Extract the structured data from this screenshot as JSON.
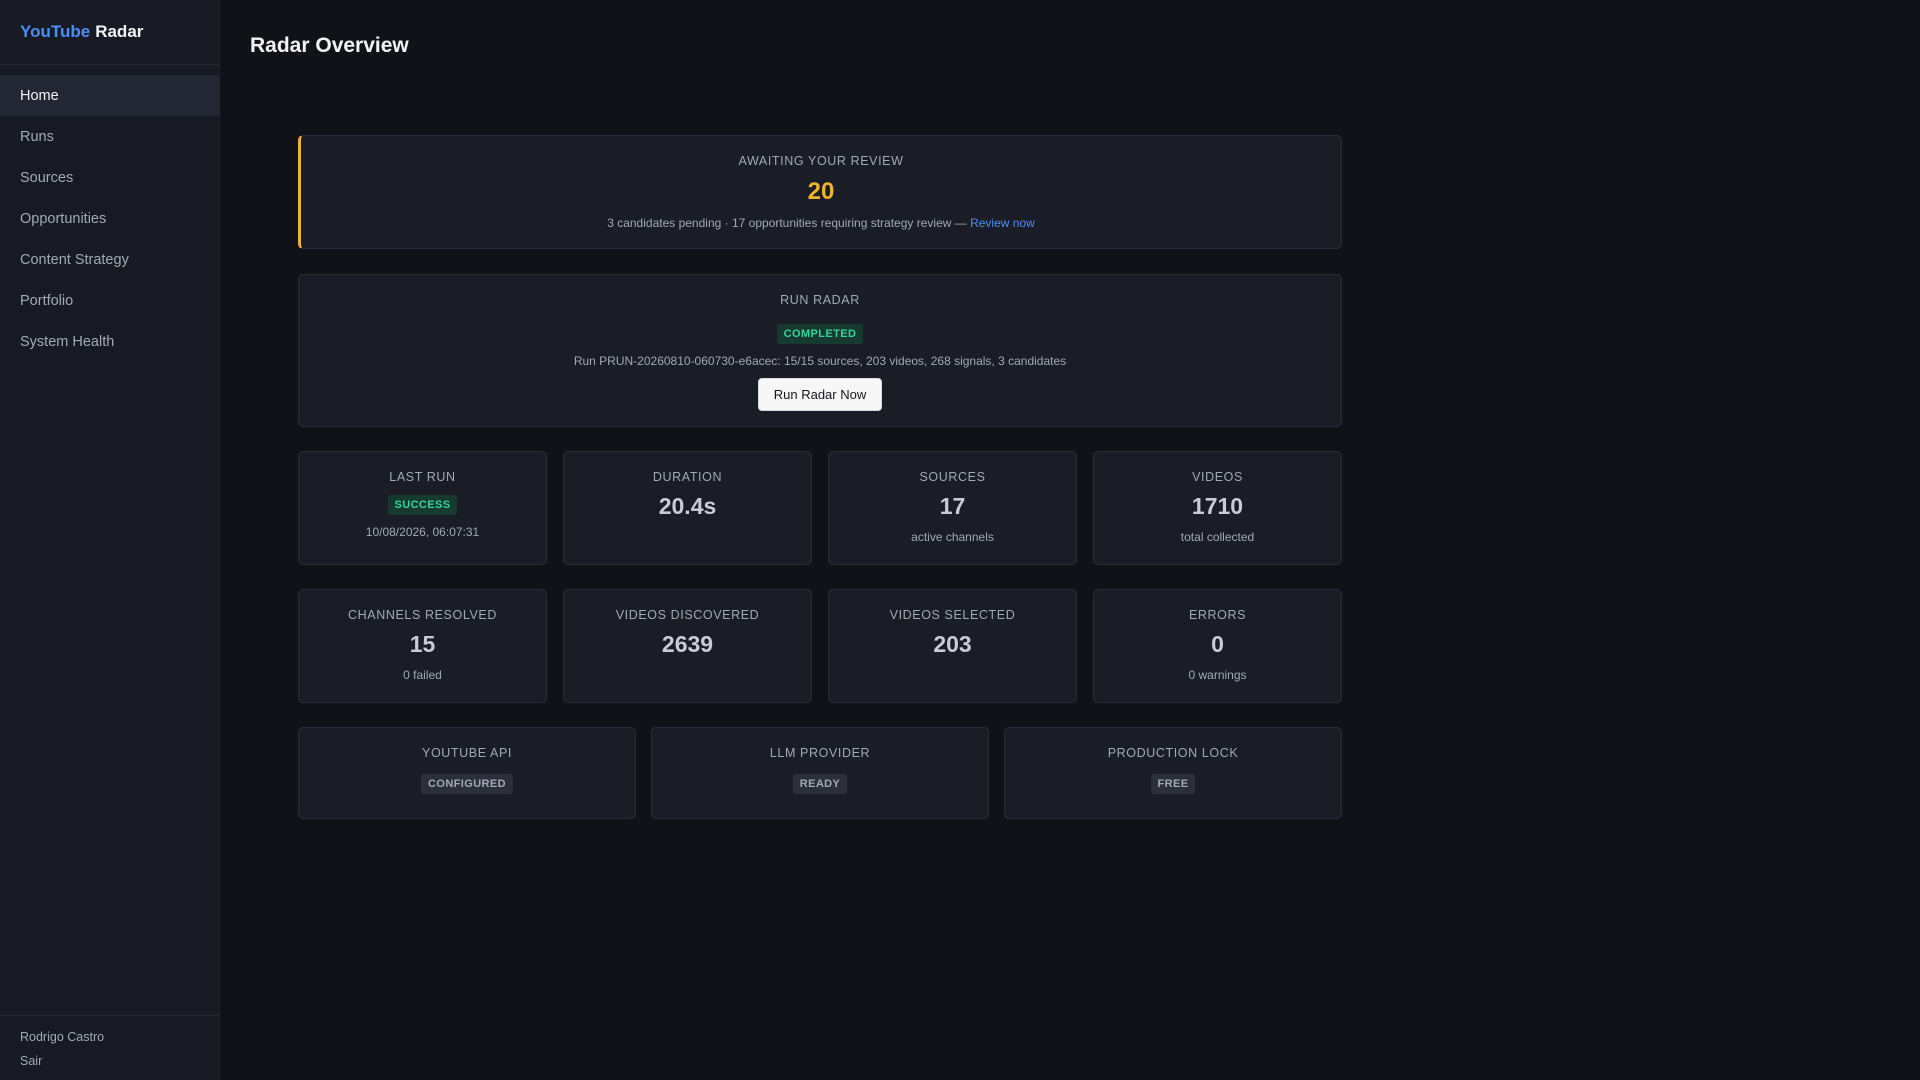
{
  "app": {
    "brand_part1": "YouTube",
    "brand_part2": "Radar",
    "accent_color": "#4a8ff7"
  },
  "sidebar": {
    "items": [
      {
        "label": "Home",
        "active": true
      },
      {
        "label": "Runs"
      },
      {
        "label": "Sources"
      },
      {
        "label": "Opportunities"
      },
      {
        "label": "Content Strategy"
      },
      {
        "label": "Portfolio"
      },
      {
        "label": "System Health"
      }
    ],
    "user_name": "Rodrigo Castro",
    "logout_label": "Sair"
  },
  "page": {
    "title": "Radar Overview"
  },
  "review": {
    "label": "AWAITING YOUR REVIEW",
    "count": "20",
    "text": "3 candidates pending · 17 opportunities requiring strategy review — ",
    "link": "Review now",
    "color": "#f0b429"
  },
  "run": {
    "label": "RUN RADAR",
    "status": "COMPLETED",
    "info": "Run PRUN-20260810-060730-e6acec: 15/15 sources, 203 videos, 268 signals, 3 candidates",
    "button": "Run Radar Now"
  },
  "stats_row1": [
    {
      "label": "LAST RUN",
      "badge": "SUCCESS",
      "sub": "10/08/2026, 06:07:31"
    },
    {
      "label": "DURATION",
      "value": "20.4s"
    },
    {
      "label": "SOURCES",
      "value": "17",
      "sub": "active channels"
    },
    {
      "label": "VIDEOS",
      "value": "1710",
      "sub": "total collected"
    }
  ],
  "stats_row2": [
    {
      "label": "CHANNELS RESOLVED",
      "value": "15",
      "sub": "0 failed"
    },
    {
      "label": "VIDEOS DISCOVERED",
      "value": "2639"
    },
    {
      "label": "VIDEOS SELECTED",
      "value": "203"
    },
    {
      "label": "ERRORS",
      "value": "0",
      "sub": "0 warnings"
    }
  ],
  "health": [
    {
      "label": "YOUTUBE API",
      "badge": "CONFIGURED"
    },
    {
      "label": "LLM PROVIDER",
      "badge": "READY"
    },
    {
      "label": "PRODUCTION LOCK",
      "badge": "FREE"
    }
  ],
  "colors": {
    "success_bg": "#163a30",
    "success_fg": "#35d39a",
    "neutral_bg": "#2c2f3a",
    "neutral_fg": "#a3a8b6"
  }
}
